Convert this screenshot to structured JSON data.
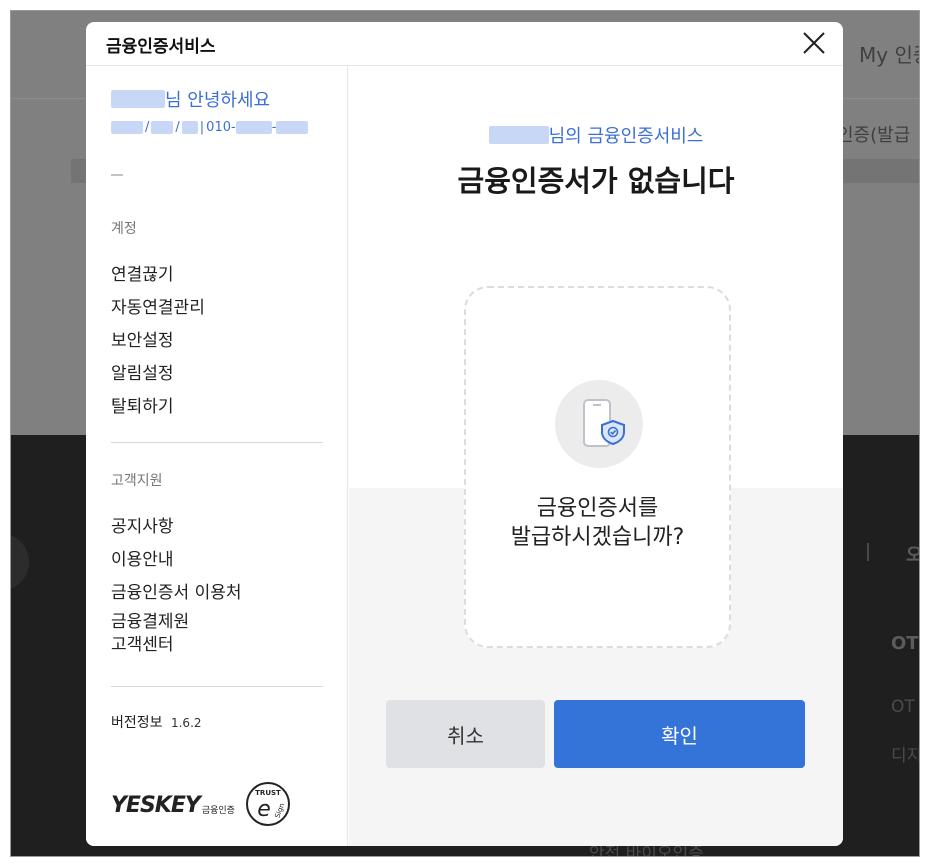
{
  "background": {
    "header_text": "My 인증",
    "tab_text": "인증(발급",
    "dark_heading": "OT",
    "dark_line1": "OT",
    "dark_line2": "디지",
    "dark_right_char": "오",
    "dark_bottom_text": "안전 바이오인증"
  },
  "modal": {
    "title": "금융인증서비스"
  },
  "sidebar": {
    "greeting_suffix": "님 안녕하세요",
    "phone_prefix": "010-",
    "phone_sep": "-",
    "section_account": "계정",
    "account_items": [
      "연결끊기",
      "자동연결관리",
      "보안설정",
      "알림설정",
      "탈퇴하기"
    ],
    "section_support": "고객지원",
    "support_items": [
      "공지사항",
      "이용안내",
      "금융인증서 이용처"
    ],
    "support_center_line1": "금융결제원",
    "support_center_line2": "고객센터",
    "version_label": "버전정보",
    "version_number": "1.6.2",
    "logo_word": "YESKEY",
    "logo_sub": "금융인증",
    "trust_top": "TRUST",
    "trust_sign": "Sign"
  },
  "main": {
    "subtitle_suffix": "님의 금융인증서비스",
    "headline": "금융인증서가 없습니다",
    "prompt_line1": "금융인증서를",
    "prompt_line2": "발급하시겠습니까?",
    "cancel_label": "취소",
    "confirm_label": "확인"
  },
  "colors": {
    "accent": "#3474d9",
    "link_blue": "#3b6fd6",
    "cancel_bg": "#e0e1e5"
  }
}
